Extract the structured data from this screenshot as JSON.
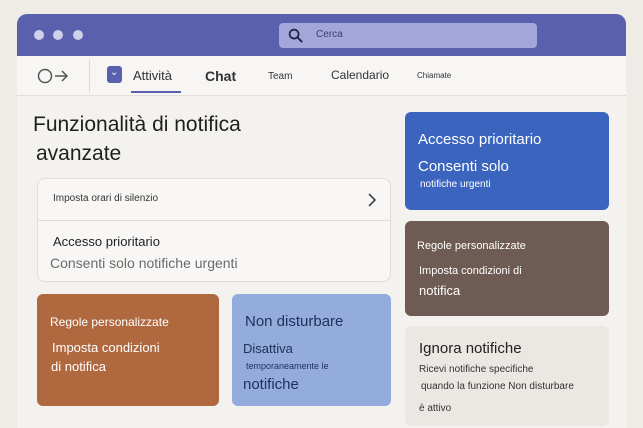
{
  "search": {
    "placeholder": "Cerca"
  },
  "tabs": [
    {
      "label": "Attività"
    },
    {
      "label": "Chat"
    },
    {
      "label": "Team"
    },
    {
      "label": "Calendario"
    },
    {
      "label": "Chiamate"
    }
  ],
  "page": {
    "title_line1": "Funzionalità di notifica",
    "title_line2": "avanzate"
  },
  "settings": {
    "quiet_hours": "Imposta orari di silenzio",
    "priority_title": "Accesso prioritario",
    "priority_desc": "Consenti solo notifiche urgenti"
  },
  "cards": {
    "custom_rules_left": {
      "title": "Regole personalizzate",
      "line1": "Imposta condizioni",
      "line2": "di notifica"
    },
    "dnd": {
      "title": "Non disturbare",
      "line1": "Disattiva",
      "line2": "temporaneamente le",
      "line3": "notifiche"
    },
    "priority": {
      "title": "Accesso prioritario",
      "line1": "Consenti solo",
      "line2": "notifiche urgenti"
    },
    "custom_rules_right": {
      "title": "Regole personalizzate",
      "line1": "Imposta condizioni di",
      "line2": "notifica"
    },
    "ignore": {
      "title": "Ignora notifiche",
      "line1": "Ricevi notifiche specifiche",
      "line2": "quando la funzione Non disturbare",
      "line3": "è attivo"
    }
  },
  "colors": {
    "brand": "#5a5fae",
    "priority_card": "#3b64bf",
    "rules_left_card": "#b0683f",
    "dnd_card": "#94acdc",
    "rules_right_card": "#6e5b53",
    "ignore_card": "#ebe8e4"
  }
}
